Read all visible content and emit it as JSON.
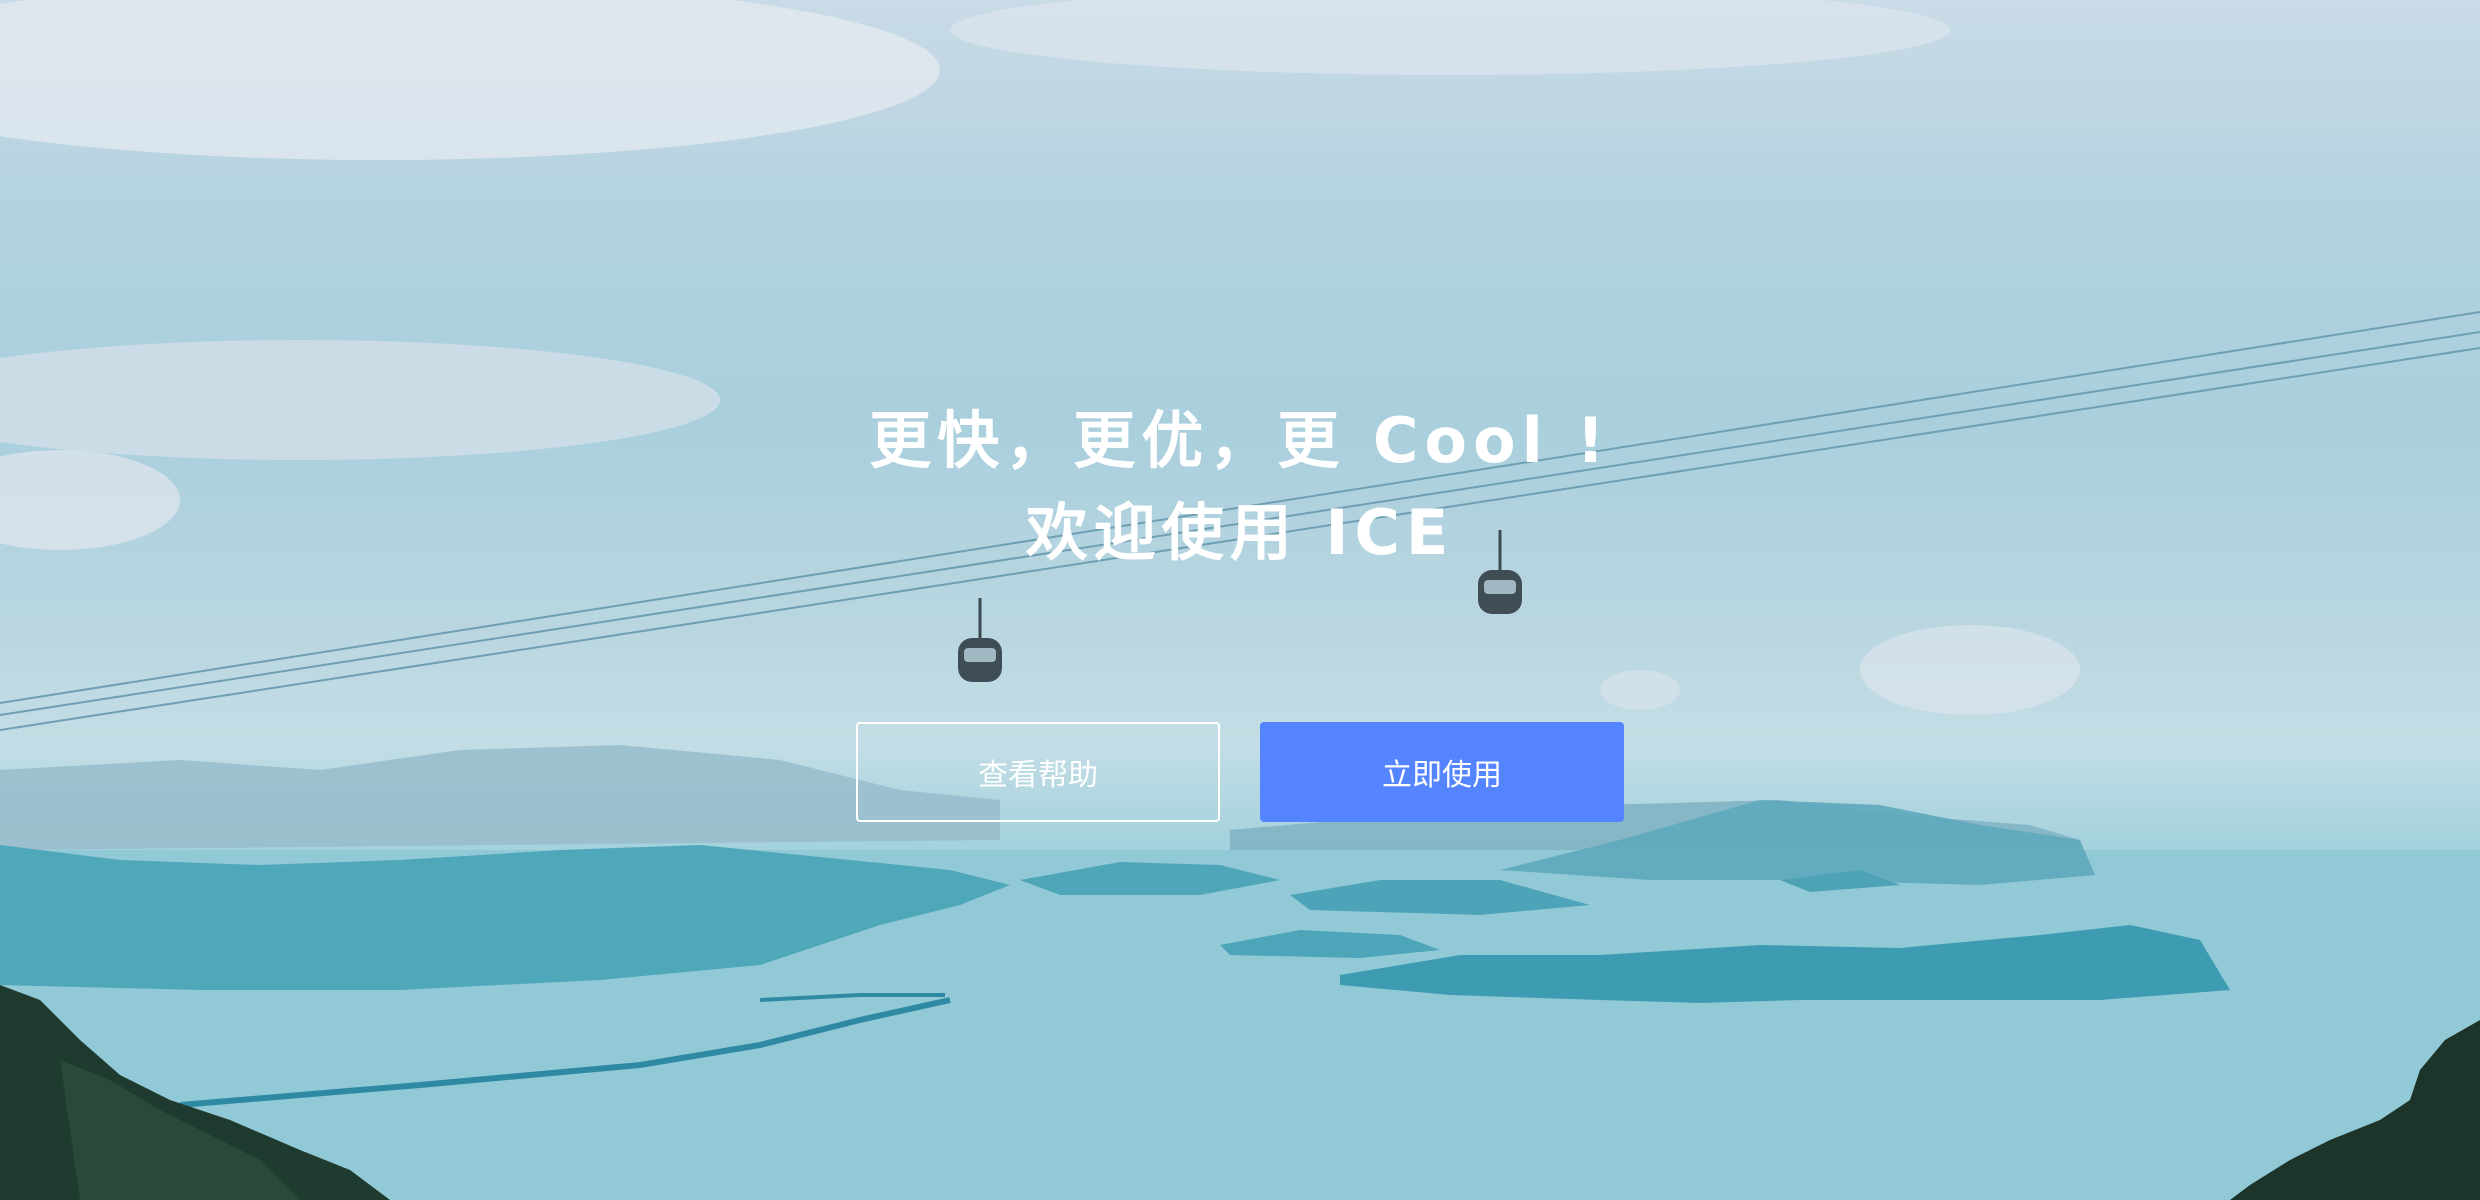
{
  "hero": {
    "title_line1": "更快，更优，更 Cool !",
    "title_line2": "欢迎使用 ICE",
    "background_image": "cable-car-over-islands-photo"
  },
  "actions": {
    "help_label": "查看帮助",
    "start_label": "立即使用"
  },
  "colors": {
    "primary": "#5484ff",
    "text": "#ffffff"
  }
}
